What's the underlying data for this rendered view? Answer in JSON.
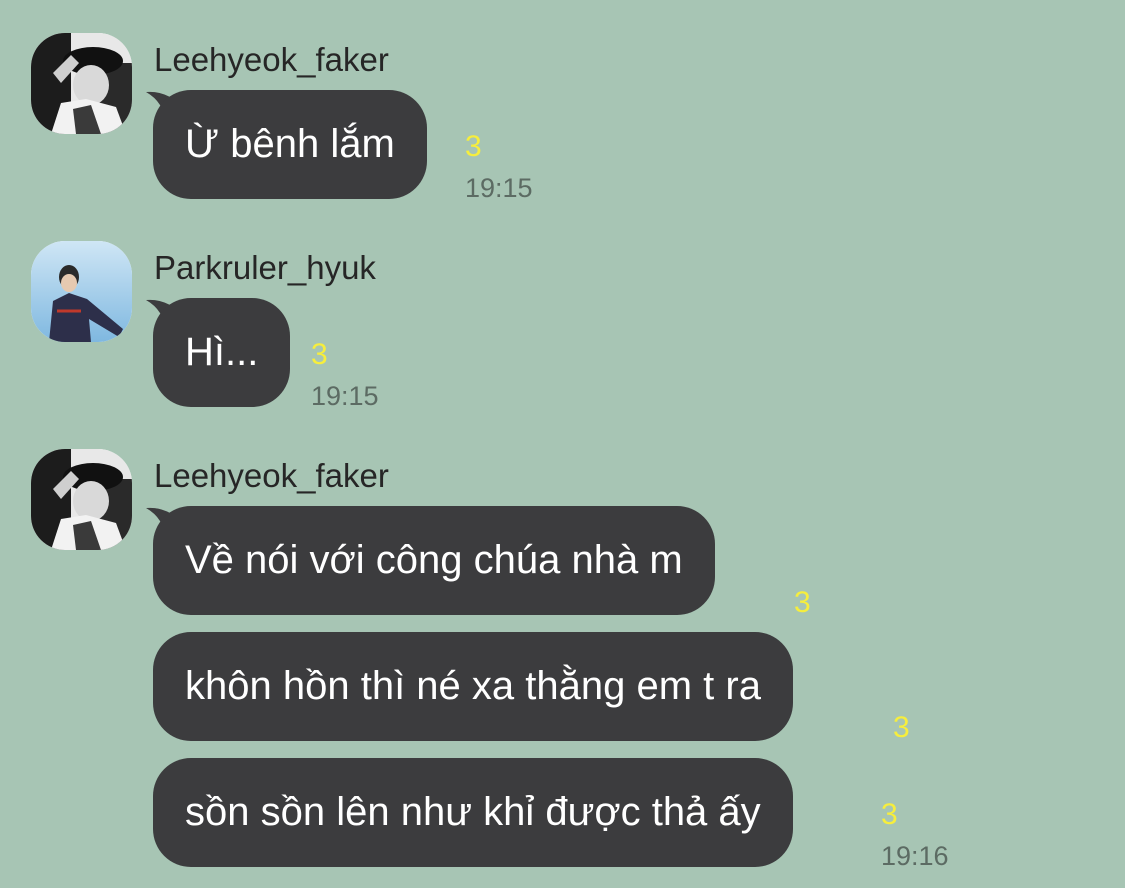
{
  "messages": [
    {
      "sender": "Leehyeok_faker",
      "avatar_icon": "faker-profile-photo",
      "bubbles": [
        {
          "text": "Ừ bênh lắm",
          "read_count": "3",
          "time": "19:15"
        }
      ]
    },
    {
      "sender": "Parkruler_hyuk",
      "avatar_icon": "ruler-profile-photo",
      "bubbles": [
        {
          "text": "Hì...",
          "read_count": "3",
          "time": "19:15"
        }
      ]
    },
    {
      "sender": "Leehyeok_faker",
      "avatar_icon": "faker-profile-photo",
      "bubbles": [
        {
          "text": "Về nói với công chúa nhà m",
          "read_count": "3"
        },
        {
          "text": "khôn hồn thì né xa thằng em t ra",
          "read_count": "3"
        },
        {
          "text": "sồn sồn lên như khỉ được thả ấy",
          "read_count": "3",
          "time": "19:16"
        }
      ]
    }
  ],
  "colors": {
    "background": "#a7c5b4",
    "bubble": "#3c3c3e",
    "bubble_text": "#ffffff",
    "read_count": "#f6ee3d",
    "time": "#5c6b63"
  }
}
